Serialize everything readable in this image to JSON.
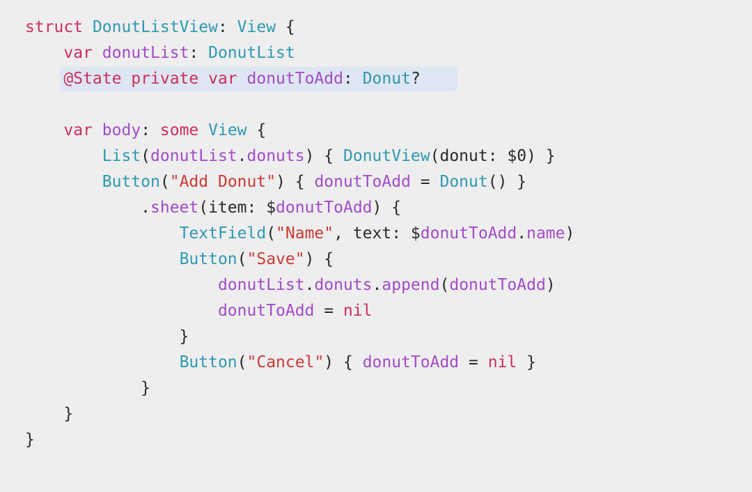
{
  "slide": {
    "highlight_color": "#dde6f2",
    "colors": {
      "keyword": "#cd2e5a",
      "type": "#2f99b1",
      "identifier": "#a34bc7",
      "string": "#cc3a33",
      "plain": "#2a2a2e",
      "background": "#eeeeef"
    },
    "code_lines": [
      {
        "highlighted": false,
        "tokens": [
          {
            "c": "kw",
            "t": "struct"
          },
          {
            "c": "plain",
            "t": " "
          },
          {
            "c": "type",
            "t": "DonutListView"
          },
          {
            "c": "plain",
            "t": ": "
          },
          {
            "c": "type",
            "t": "View"
          },
          {
            "c": "plain",
            "t": " {"
          }
        ]
      },
      {
        "highlighted": false,
        "tokens": [
          {
            "c": "plain",
            "t": "    "
          },
          {
            "c": "kw",
            "t": "var"
          },
          {
            "c": "plain",
            "t": " "
          },
          {
            "c": "ident",
            "t": "donutList"
          },
          {
            "c": "plain",
            "t": ": "
          },
          {
            "c": "type",
            "t": "DonutList"
          }
        ]
      },
      {
        "highlighted": true,
        "tokens": [
          {
            "c": "plain",
            "t": "    "
          },
          {
            "c": "kw",
            "t": "@State private var"
          },
          {
            "c": "plain",
            "t": " "
          },
          {
            "c": "ident",
            "t": "donutToAdd"
          },
          {
            "c": "plain",
            "t": ": "
          },
          {
            "c": "type",
            "t": "Donut"
          },
          {
            "c": "plain",
            "t": "?"
          }
        ]
      },
      {
        "highlighted": false,
        "tokens": [
          {
            "c": "plain",
            "t": " "
          }
        ]
      },
      {
        "highlighted": false,
        "tokens": [
          {
            "c": "plain",
            "t": "    "
          },
          {
            "c": "kw",
            "t": "var"
          },
          {
            "c": "plain",
            "t": " "
          },
          {
            "c": "ident",
            "t": "body"
          },
          {
            "c": "plain",
            "t": ": "
          },
          {
            "c": "kw",
            "t": "some"
          },
          {
            "c": "plain",
            "t": " "
          },
          {
            "c": "type",
            "t": "View"
          },
          {
            "c": "plain",
            "t": " {"
          }
        ]
      },
      {
        "highlighted": false,
        "tokens": [
          {
            "c": "plain",
            "t": "        "
          },
          {
            "c": "type",
            "t": "List"
          },
          {
            "c": "plain",
            "t": "("
          },
          {
            "c": "ident",
            "t": "donutList"
          },
          {
            "c": "plain",
            "t": "."
          },
          {
            "c": "ident",
            "t": "donuts"
          },
          {
            "c": "plain",
            "t": ") { "
          },
          {
            "c": "type",
            "t": "DonutView"
          },
          {
            "c": "plain",
            "t": "(donut: $0) }"
          }
        ]
      },
      {
        "highlighted": false,
        "tokens": [
          {
            "c": "plain",
            "t": "        "
          },
          {
            "c": "type",
            "t": "Button"
          },
          {
            "c": "plain",
            "t": "("
          },
          {
            "c": "str",
            "t": "\"Add Donut\""
          },
          {
            "c": "plain",
            "t": ") { "
          },
          {
            "c": "ident",
            "t": "donutToAdd"
          },
          {
            "c": "plain",
            "t": " = "
          },
          {
            "c": "type",
            "t": "Donut"
          },
          {
            "c": "plain",
            "t": "() }"
          }
        ]
      },
      {
        "highlighted": false,
        "tokens": [
          {
            "c": "plain",
            "t": "            ."
          },
          {
            "c": "ident",
            "t": "sheet"
          },
          {
            "c": "plain",
            "t": "(item: $"
          },
          {
            "c": "ident",
            "t": "donutToAdd"
          },
          {
            "c": "plain",
            "t": ") {"
          }
        ]
      },
      {
        "highlighted": false,
        "tokens": [
          {
            "c": "plain",
            "t": "                "
          },
          {
            "c": "type",
            "t": "TextField"
          },
          {
            "c": "plain",
            "t": "("
          },
          {
            "c": "str",
            "t": "\"Name\""
          },
          {
            "c": "plain",
            "t": ", text: $"
          },
          {
            "c": "ident",
            "t": "donutToAdd"
          },
          {
            "c": "plain",
            "t": "."
          },
          {
            "c": "ident",
            "t": "name"
          },
          {
            "c": "plain",
            "t": ")"
          }
        ]
      },
      {
        "highlighted": false,
        "tokens": [
          {
            "c": "plain",
            "t": "                "
          },
          {
            "c": "type",
            "t": "Button"
          },
          {
            "c": "plain",
            "t": "("
          },
          {
            "c": "str",
            "t": "\"Save\""
          },
          {
            "c": "plain",
            "t": ") {"
          }
        ]
      },
      {
        "highlighted": false,
        "tokens": [
          {
            "c": "plain",
            "t": "                    "
          },
          {
            "c": "ident",
            "t": "donutList"
          },
          {
            "c": "plain",
            "t": "."
          },
          {
            "c": "ident",
            "t": "donuts"
          },
          {
            "c": "plain",
            "t": "."
          },
          {
            "c": "ident",
            "t": "append"
          },
          {
            "c": "plain",
            "t": "("
          },
          {
            "c": "ident",
            "t": "donutToAdd"
          },
          {
            "c": "plain",
            "t": ")"
          }
        ]
      },
      {
        "highlighted": false,
        "tokens": [
          {
            "c": "plain",
            "t": "                    "
          },
          {
            "c": "ident",
            "t": "donutToAdd"
          },
          {
            "c": "plain",
            "t": " = "
          },
          {
            "c": "kw",
            "t": "nil"
          }
        ]
      },
      {
        "highlighted": false,
        "tokens": [
          {
            "c": "plain",
            "t": "                }"
          }
        ]
      },
      {
        "highlighted": false,
        "tokens": [
          {
            "c": "plain",
            "t": "                "
          },
          {
            "c": "type",
            "t": "Button"
          },
          {
            "c": "plain",
            "t": "("
          },
          {
            "c": "str",
            "t": "\"Cancel\""
          },
          {
            "c": "plain",
            "t": ") { "
          },
          {
            "c": "ident",
            "t": "donutToAdd"
          },
          {
            "c": "plain",
            "t": " = "
          },
          {
            "c": "kw",
            "t": "nil"
          },
          {
            "c": "plain",
            "t": " }"
          }
        ]
      },
      {
        "highlighted": false,
        "tokens": [
          {
            "c": "plain",
            "t": "            }"
          }
        ]
      },
      {
        "highlighted": false,
        "tokens": [
          {
            "c": "plain",
            "t": "    }"
          }
        ]
      },
      {
        "highlighted": false,
        "tokens": [
          {
            "c": "plain",
            "t": "}"
          }
        ]
      }
    ]
  }
}
